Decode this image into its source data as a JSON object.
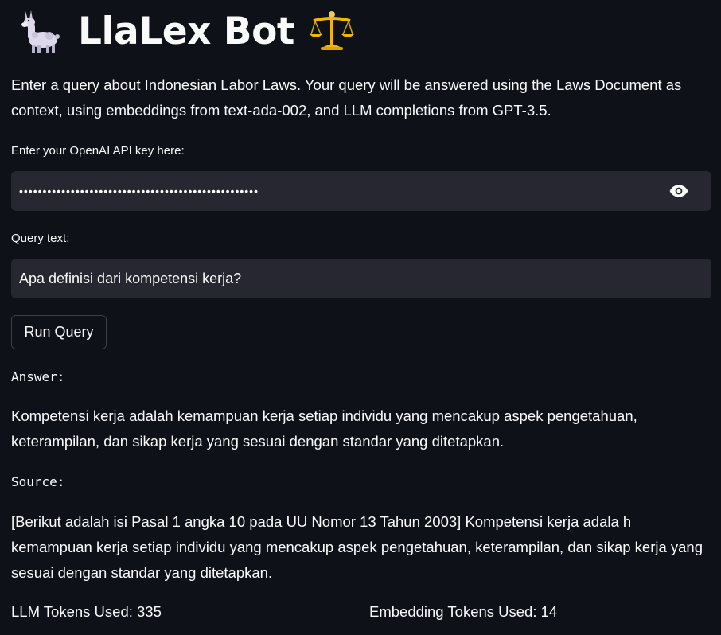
{
  "header": {
    "title": "LlaLex Bot",
    "left_icon": "llama-icon",
    "right_icon": "balance-scale-icon"
  },
  "intro": "Enter a query about Indonesian Labor Laws. Your query will be answered using the Laws Document as context, using embeddings from text-ada-002, and LLM completions from GPT-3.5.",
  "api_key": {
    "label": "Enter your OpenAI API key here:",
    "masked_value": "•••••••••••••••••••••••••••••••••••••••••••••••••••",
    "visibility_icon": "eye-icon"
  },
  "query": {
    "label": "Query text:",
    "value": "Apa definisi dari kompetensi kerja?"
  },
  "run_button": {
    "label": "Run Query"
  },
  "answer": {
    "label": "Answer:",
    "text": "Kompetensi kerja adalah kemampuan kerja setiap individu yang mencakup aspek pengetahuan, keterampilan, dan sikap kerja yang sesuai dengan standar yang ditetapkan."
  },
  "source": {
    "label": "Source:",
    "text": "[Berikut adalah isi Pasal 1 angka 10 pada UU Nomor 13 Tahun 2003] Kompetensi kerja adala h kemampuan kerja setiap individu yang mencakup aspek pengetahuan, keterampilan, dan sikap kerja yang sesuai dengan standar yang ditetapkan."
  },
  "stats": {
    "llm_tokens": "LLM Tokens Used: 335",
    "embedding_tokens": "Embedding Tokens Used: 14"
  },
  "colors": {
    "background": "#0e1117",
    "input_background": "#262730",
    "text": "#fafafa",
    "scale_gold": "#f2b705"
  }
}
